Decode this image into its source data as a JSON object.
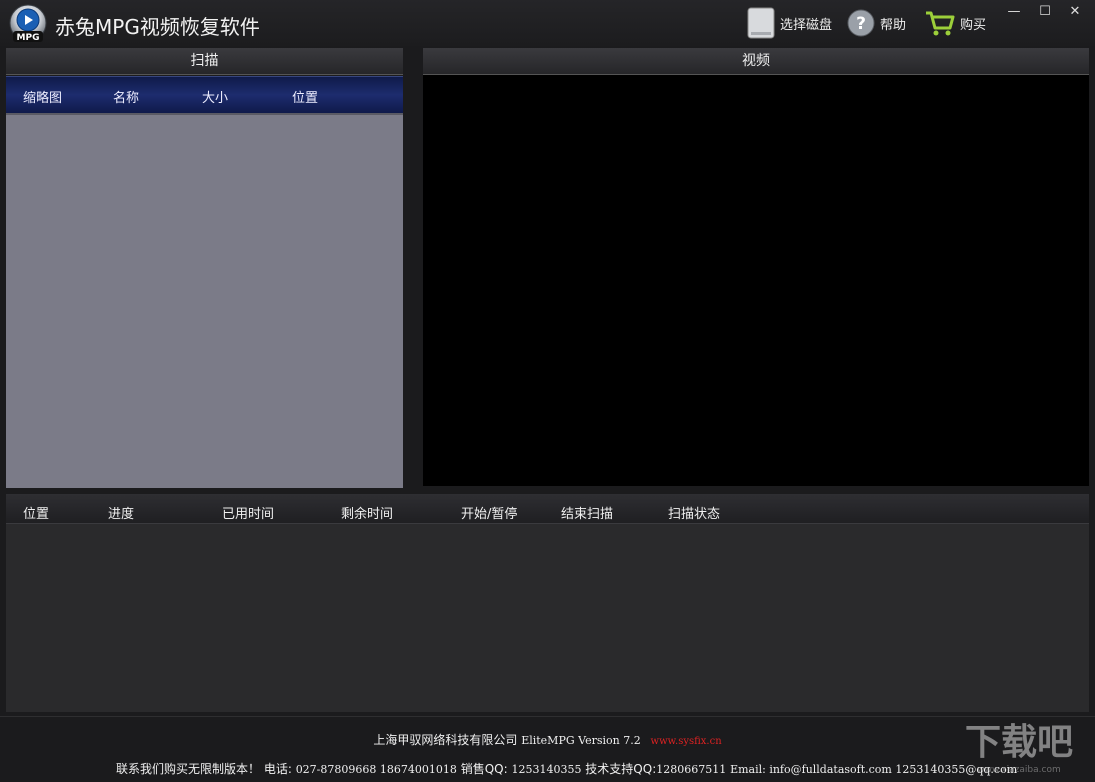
{
  "window": {
    "title": "赤兔MPG视频恢复软件",
    "logo_text": "MPG",
    "minimize": "—",
    "maximize": "☐",
    "close": "✕"
  },
  "toolbar": {
    "select_disk": "选择磁盘",
    "help": "帮助",
    "buy": "购买"
  },
  "scan_panel": {
    "title": "扫描",
    "columns": [
      "缩略图",
      "名称",
      "大小",
      "位置"
    ]
  },
  "video_panel": {
    "title": "视频"
  },
  "status_table": {
    "columns": [
      "位置",
      "进度",
      "已用时间",
      "剩余时间",
      "开始/暂停",
      "结束扫描",
      "扫描状态"
    ]
  },
  "footer": {
    "company": "上海甲驭网络科技有限公司",
    "version": "EliteMPG Version 7.2",
    "website": "www.sysfix.cn",
    "contact_prefix": "联系我们购买无限制版本！ 电话:",
    "phones": "027-87809668 18674001018",
    "sales_label": "销售QQ:",
    "sales_qq": "1253140355",
    "support_label": "技术支持QQ:",
    "support_qq": "1280667511",
    "email": "Email: info@fulldatasoft.com 1253140355@qq.com"
  },
  "watermark": {
    "text": "下载吧",
    "url": "www.xiazaiba.com"
  },
  "colors": {
    "scan_list_bg": "#7b7b88",
    "scan_header_bg": "#1d2c6e",
    "video_bg": "#000000",
    "website_link": "#dd2222"
  }
}
